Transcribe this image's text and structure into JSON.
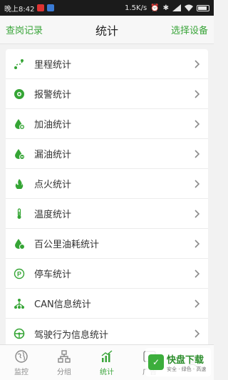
{
  "status_bar": {
    "time": "晚上8:42",
    "speed": "1.5K/s"
  },
  "header": {
    "left_link": "查岗记录",
    "title": "统计",
    "right_link": "选择设备"
  },
  "colors": {
    "accent": "#3aa53a",
    "icon": "#35a535",
    "chevron": "#8a8a8a"
  },
  "items": [
    {
      "label": "里程统计",
      "icon": "route-icon"
    },
    {
      "label": "报警统计",
      "icon": "alarm-icon"
    },
    {
      "label": "加油统计",
      "icon": "refuel-icon"
    },
    {
      "label": "漏油统计",
      "icon": "oil-leak-icon"
    },
    {
      "label": "点火统计",
      "icon": "ignition-icon"
    },
    {
      "label": "温度统计",
      "icon": "thermometer-icon"
    },
    {
      "label": "百公里油耗统计",
      "icon": "fuel-consumption-icon"
    },
    {
      "label": "停车统计",
      "icon": "parking-icon"
    },
    {
      "label": "CAN信息统计",
      "icon": "can-info-icon"
    },
    {
      "label": "驾驶行为信息统计",
      "icon": "steering-wheel-icon"
    }
  ],
  "tabs": [
    {
      "label": "监控",
      "icon": "globe-icon"
    },
    {
      "label": "分组",
      "icon": "group-icon"
    },
    {
      "label": "统计",
      "icon": "bar-chart-icon",
      "active": true
    },
    {
      "label": "广告",
      "icon": "ad-icon"
    },
    {
      "label": "",
      "icon": "profile-icon"
    }
  ],
  "watermark": {
    "main": "快盘下载",
    "sub": "安全 · 绿色 · 高速"
  }
}
